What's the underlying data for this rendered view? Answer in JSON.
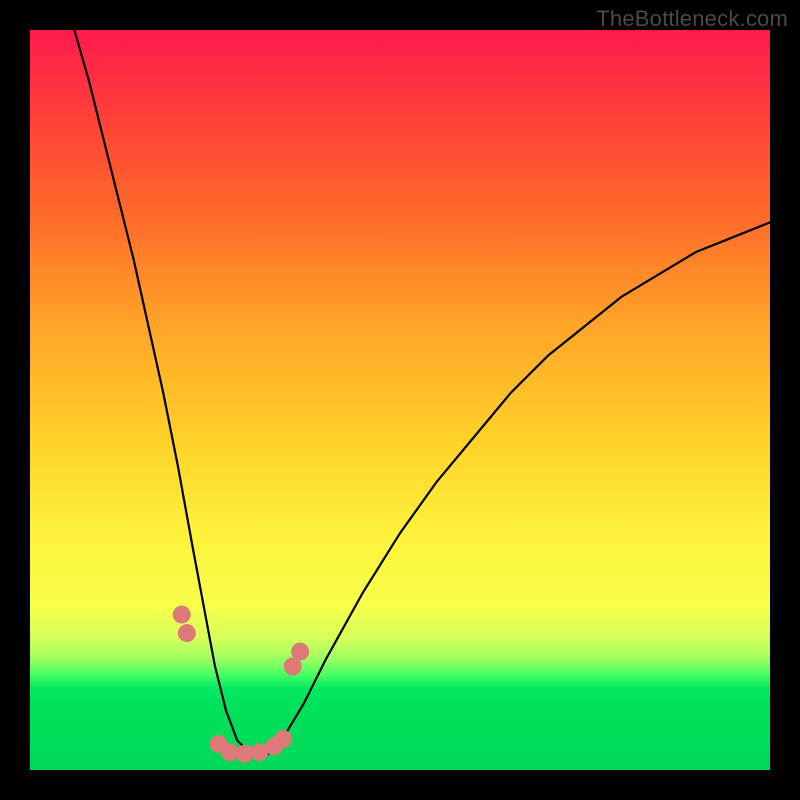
{
  "watermark": "TheBottleneck.com",
  "chart_data": {
    "type": "line",
    "title": "",
    "xlabel": "",
    "ylabel": "",
    "xlim": [
      0,
      100
    ],
    "ylim": [
      0,
      100
    ],
    "grid": false,
    "legend": false,
    "background_gradient": {
      "orientation": "vertical",
      "stops": [
        {
          "pos": 0.0,
          "color": "#ff1a4d"
        },
        {
          "pos": 0.25,
          "color": "#ff6a2a"
        },
        {
          "pos": 0.55,
          "color": "#ffd028"
        },
        {
          "pos": 0.78,
          "color": "#f6ff4a"
        },
        {
          "pos": 0.87,
          "color": "#4cff63"
        },
        {
          "pos": 1.0,
          "color": "#00d858"
        }
      ]
    },
    "series": [
      {
        "name": "bottleneck-curve",
        "x": [
          6,
          8,
          10,
          12,
          14,
          16,
          18,
          20,
          22,
          23.5,
          25,
          26.5,
          28,
          30,
          32,
          34,
          37,
          40,
          45,
          50,
          55,
          60,
          65,
          70,
          75,
          80,
          85,
          90,
          95,
          100
        ],
        "y": [
          100,
          93,
          85,
          77,
          69,
          60,
          51,
          41,
          30,
          22,
          14,
          8,
          4,
          2,
          2,
          4,
          9,
          15,
          24,
          32,
          39,
          45,
          51,
          56,
          60,
          64,
          67,
          70,
          72,
          74
        ]
      }
    ],
    "markers": [
      {
        "x": 20.5,
        "y": 21
      },
      {
        "x": 21.2,
        "y": 18.5
      },
      {
        "x": 25.5,
        "y": 3.5
      },
      {
        "x": 27.0,
        "y": 2.4
      },
      {
        "x": 29.0,
        "y": 2.2
      },
      {
        "x": 31.0,
        "y": 2.4
      },
      {
        "x": 33.0,
        "y": 3.2
      },
      {
        "x": 34.2,
        "y": 4.2
      },
      {
        "x": 35.5,
        "y": 14.0
      },
      {
        "x": 36.5,
        "y": 16.0
      }
    ],
    "marker_color": "#dd7a78",
    "marker_radius_px": 9
  }
}
